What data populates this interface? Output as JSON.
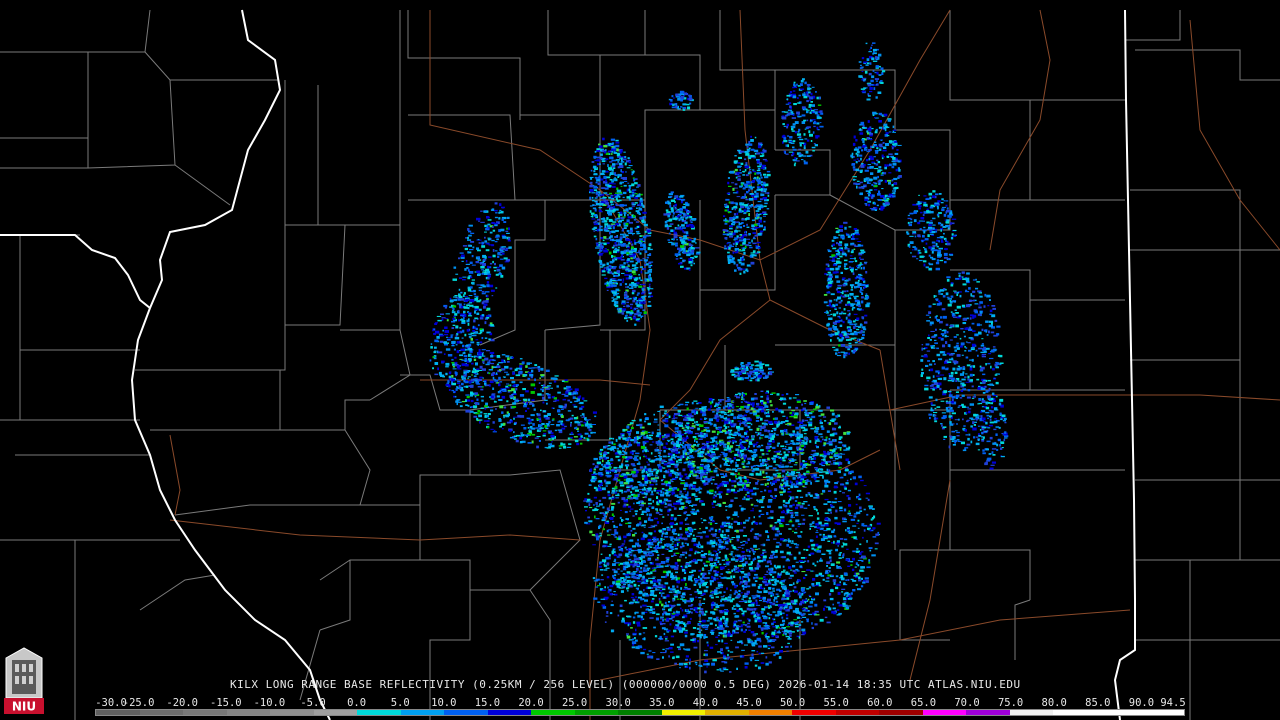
{
  "product_title": "KILX LONG RANGE BASE REFLECTIVITY (0.25KM / 256 LEVEL) (000000/0000 0.5 DEG) 2026-01-14 18:35 UTC  ATLAS.NIU.EDU",
  "logo_text": "NIU",
  "legend": {
    "ticks": [
      "-30.0",
      "-25.0",
      "-20.0",
      "-15.0",
      "-10.0",
      "-5.0",
      "0.0",
      "5.0",
      "10.0",
      "15.0",
      "20.0",
      "25.0",
      "30.0",
      "35.0",
      "40.0",
      "45.0",
      "50.0",
      "55.0",
      "60.0",
      "65.0",
      "70.0",
      "75.0",
      "80.0",
      "85.0",
      "90.0",
      "94.5"
    ],
    "colors": [
      "#606060",
      "#6c6c6c",
      "#787878",
      "#848484",
      "#909090",
      "#a0a0a0",
      "#00d8d8",
      "#00a0f0",
      "#0060f0",
      "#0000d8",
      "#00c800",
      "#00a000",
      "#008000",
      "#f0f000",
      "#e0b000",
      "#f08000",
      "#f00000",
      "#c00000",
      "#a00000",
      "#ff00ff",
      "#a000d8",
      "#f0f0f0",
      "#ffffff",
      "#ffffff",
      "#ffffff"
    ]
  },
  "map_colors": {
    "background": "#000000",
    "county_lines": "#7a7a7a",
    "state_lines": "#ffffff",
    "highways": "#8a4a2a"
  }
}
